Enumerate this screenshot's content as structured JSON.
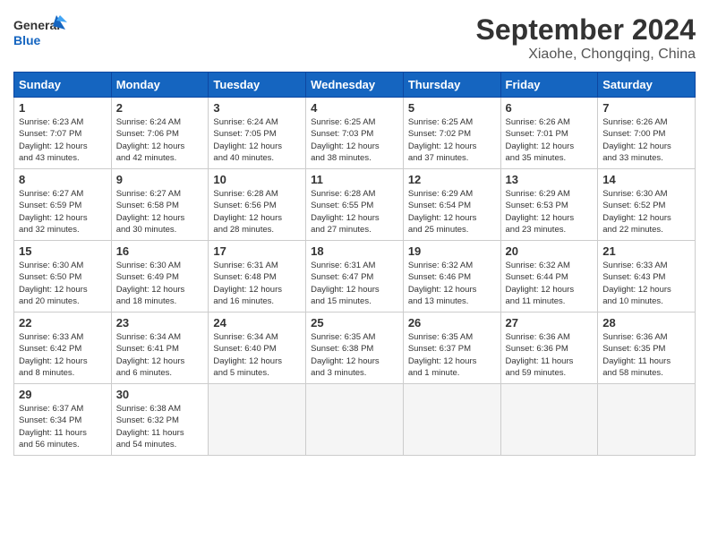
{
  "header": {
    "logo_line1": "General",
    "logo_line2": "Blue",
    "month": "September 2024",
    "location": "Xiaohe, Chongqing, China"
  },
  "weekdays": [
    "Sunday",
    "Monday",
    "Tuesday",
    "Wednesday",
    "Thursday",
    "Friday",
    "Saturday"
  ],
  "weeks": [
    [
      {
        "day": "1",
        "info": "Sunrise: 6:23 AM\nSunset: 7:07 PM\nDaylight: 12 hours\nand 43 minutes."
      },
      {
        "day": "2",
        "info": "Sunrise: 6:24 AM\nSunset: 7:06 PM\nDaylight: 12 hours\nand 42 minutes."
      },
      {
        "day": "3",
        "info": "Sunrise: 6:24 AM\nSunset: 7:05 PM\nDaylight: 12 hours\nand 40 minutes."
      },
      {
        "day": "4",
        "info": "Sunrise: 6:25 AM\nSunset: 7:03 PM\nDaylight: 12 hours\nand 38 minutes."
      },
      {
        "day": "5",
        "info": "Sunrise: 6:25 AM\nSunset: 7:02 PM\nDaylight: 12 hours\nand 37 minutes."
      },
      {
        "day": "6",
        "info": "Sunrise: 6:26 AM\nSunset: 7:01 PM\nDaylight: 12 hours\nand 35 minutes."
      },
      {
        "day": "7",
        "info": "Sunrise: 6:26 AM\nSunset: 7:00 PM\nDaylight: 12 hours\nand 33 minutes."
      }
    ],
    [
      {
        "day": "8",
        "info": "Sunrise: 6:27 AM\nSunset: 6:59 PM\nDaylight: 12 hours\nand 32 minutes."
      },
      {
        "day": "9",
        "info": "Sunrise: 6:27 AM\nSunset: 6:58 PM\nDaylight: 12 hours\nand 30 minutes."
      },
      {
        "day": "10",
        "info": "Sunrise: 6:28 AM\nSunset: 6:56 PM\nDaylight: 12 hours\nand 28 minutes."
      },
      {
        "day": "11",
        "info": "Sunrise: 6:28 AM\nSunset: 6:55 PM\nDaylight: 12 hours\nand 27 minutes."
      },
      {
        "day": "12",
        "info": "Sunrise: 6:29 AM\nSunset: 6:54 PM\nDaylight: 12 hours\nand 25 minutes."
      },
      {
        "day": "13",
        "info": "Sunrise: 6:29 AM\nSunset: 6:53 PM\nDaylight: 12 hours\nand 23 minutes."
      },
      {
        "day": "14",
        "info": "Sunrise: 6:30 AM\nSunset: 6:52 PM\nDaylight: 12 hours\nand 22 minutes."
      }
    ],
    [
      {
        "day": "15",
        "info": "Sunrise: 6:30 AM\nSunset: 6:50 PM\nDaylight: 12 hours\nand 20 minutes."
      },
      {
        "day": "16",
        "info": "Sunrise: 6:30 AM\nSunset: 6:49 PM\nDaylight: 12 hours\nand 18 minutes."
      },
      {
        "day": "17",
        "info": "Sunrise: 6:31 AM\nSunset: 6:48 PM\nDaylight: 12 hours\nand 16 minutes."
      },
      {
        "day": "18",
        "info": "Sunrise: 6:31 AM\nSunset: 6:47 PM\nDaylight: 12 hours\nand 15 minutes."
      },
      {
        "day": "19",
        "info": "Sunrise: 6:32 AM\nSunset: 6:46 PM\nDaylight: 12 hours\nand 13 minutes."
      },
      {
        "day": "20",
        "info": "Sunrise: 6:32 AM\nSunset: 6:44 PM\nDaylight: 12 hours\nand 11 minutes."
      },
      {
        "day": "21",
        "info": "Sunrise: 6:33 AM\nSunset: 6:43 PM\nDaylight: 12 hours\nand 10 minutes."
      }
    ],
    [
      {
        "day": "22",
        "info": "Sunrise: 6:33 AM\nSunset: 6:42 PM\nDaylight: 12 hours\nand 8 minutes."
      },
      {
        "day": "23",
        "info": "Sunrise: 6:34 AM\nSunset: 6:41 PM\nDaylight: 12 hours\nand 6 minutes."
      },
      {
        "day": "24",
        "info": "Sunrise: 6:34 AM\nSunset: 6:40 PM\nDaylight: 12 hours\nand 5 minutes."
      },
      {
        "day": "25",
        "info": "Sunrise: 6:35 AM\nSunset: 6:38 PM\nDaylight: 12 hours\nand 3 minutes."
      },
      {
        "day": "26",
        "info": "Sunrise: 6:35 AM\nSunset: 6:37 PM\nDaylight: 12 hours\nand 1 minute."
      },
      {
        "day": "27",
        "info": "Sunrise: 6:36 AM\nSunset: 6:36 PM\nDaylight: 11 hours\nand 59 minutes."
      },
      {
        "day": "28",
        "info": "Sunrise: 6:36 AM\nSunset: 6:35 PM\nDaylight: 11 hours\nand 58 minutes."
      }
    ],
    [
      {
        "day": "29",
        "info": "Sunrise: 6:37 AM\nSunset: 6:34 PM\nDaylight: 11 hours\nand 56 minutes."
      },
      {
        "day": "30",
        "info": "Sunrise: 6:38 AM\nSunset: 6:32 PM\nDaylight: 11 hours\nand 54 minutes."
      },
      {
        "day": "",
        "info": ""
      },
      {
        "day": "",
        "info": ""
      },
      {
        "day": "",
        "info": ""
      },
      {
        "day": "",
        "info": ""
      },
      {
        "day": "",
        "info": ""
      }
    ]
  ]
}
